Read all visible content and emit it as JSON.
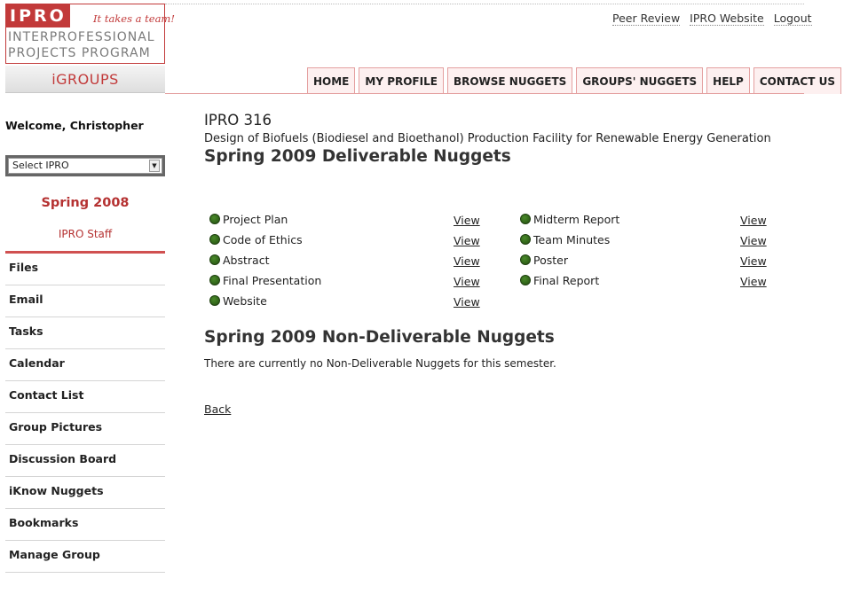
{
  "logo": {
    "brand": "IPRO",
    "tagline": "It takes a team!",
    "line1": "INTERPROFESSIONAL",
    "line2": "PROJECTS PROGRAM",
    "app_name": "iGROUPS"
  },
  "top_links": [
    "Peer Review",
    "IPRO Website",
    "Logout"
  ],
  "nav_tabs": [
    "HOME",
    "MY PROFILE",
    "BROWSE NUGGETS",
    "GROUPS' NUGGETS",
    "HELP",
    "CONTACT US"
  ],
  "sidebar": {
    "welcome": "Welcome, Christopher",
    "select_value": "Select IPRO",
    "semester": "Spring 2008",
    "group": "IPRO Staff",
    "menu": [
      "Files",
      "Email",
      "Tasks",
      "Calendar",
      "Contact List",
      "Group Pictures",
      "Discussion Board",
      "iKnow Nuggets",
      "Bookmarks",
      "Manage Group"
    ]
  },
  "main": {
    "course": "IPRO 316",
    "description": "Design of Biofuels (Biodiesel and Bioethanol) Production Facility for Renewable Energy Generation",
    "deliverable_heading": "Spring 2009 Deliverable Nuggets",
    "view_label": "View",
    "left_nuggets": [
      "Project Plan",
      "Code of Ethics",
      "Abstract",
      "Final Presentation",
      "Website"
    ],
    "right_nuggets": [
      "Midterm Report",
      "Team Minutes",
      "Poster",
      "Final Report"
    ],
    "non_deliverable_heading": "Spring 2009 Non-Deliverable Nuggets",
    "non_deliverable_text": "There are currently no Non-Deliverable Nuggets for this semester.",
    "back_label": "Back"
  },
  "colors": {
    "brand_red": "#c23a3a",
    "nugget_green": "#2f6a18"
  }
}
